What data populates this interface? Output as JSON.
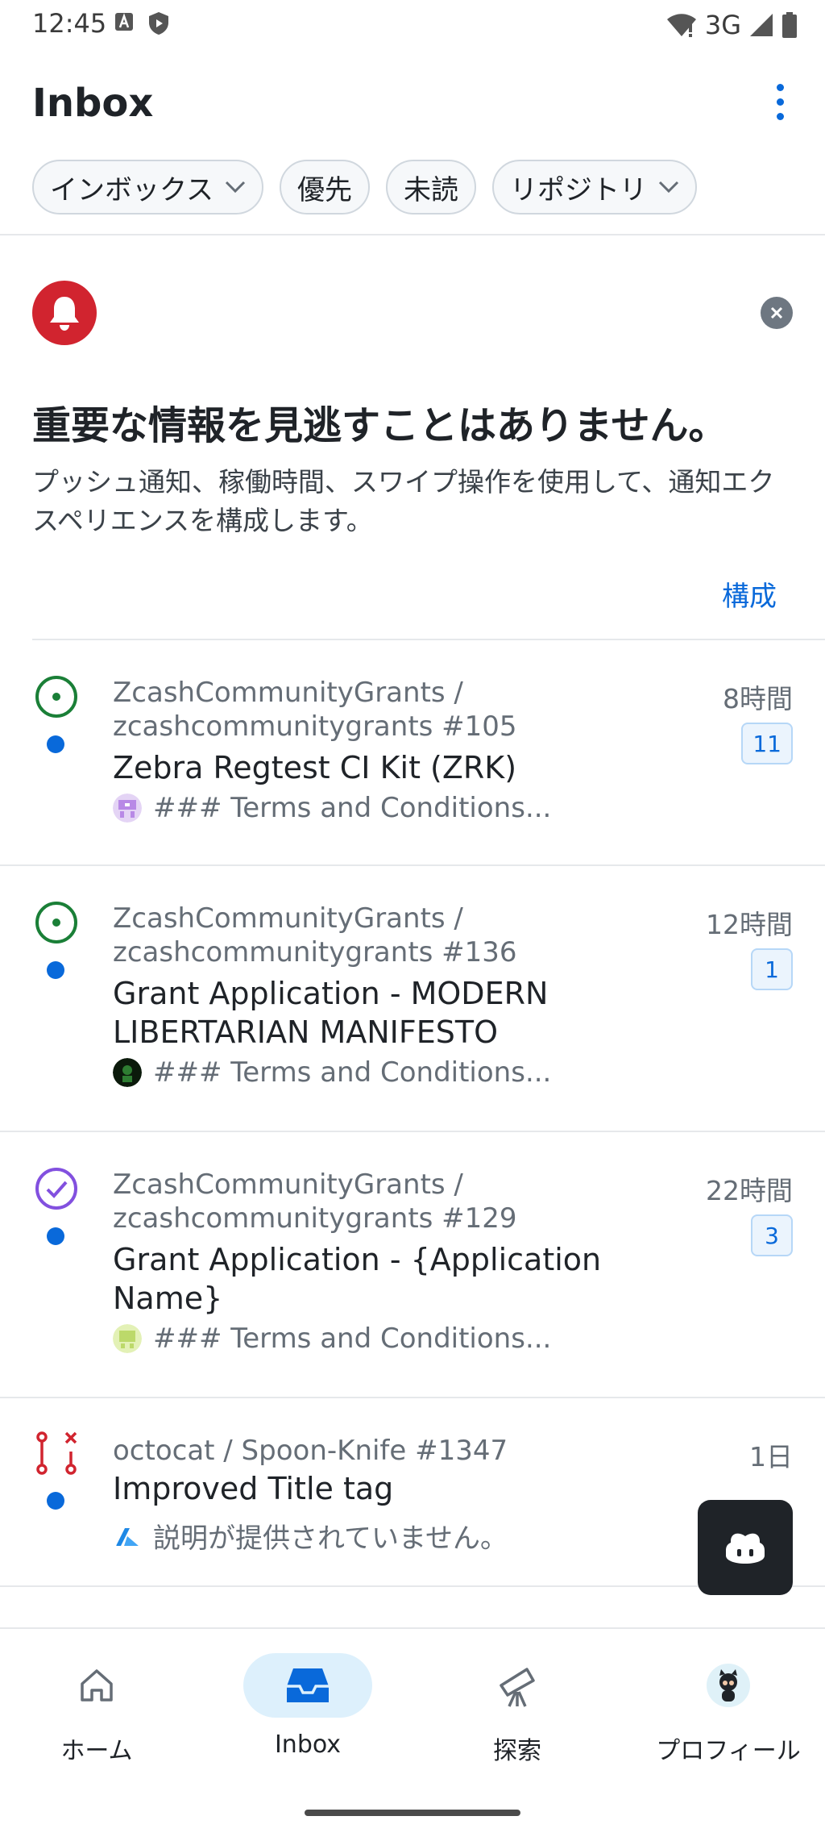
{
  "status_bar": {
    "time": "12:45",
    "network": "3G",
    "icons": [
      "a-box-icon",
      "shield-icon",
      "wifi-icon",
      "signal-icon",
      "battery-icon"
    ]
  },
  "header": {
    "title": "Inbox",
    "menu_icon": "kebab-menu-icon"
  },
  "filters": [
    {
      "label": "インボックス",
      "has_dropdown": true
    },
    {
      "label": "優先",
      "has_dropdown": false
    },
    {
      "label": "未読",
      "has_dropdown": false
    },
    {
      "label": "リポジトリ",
      "has_dropdown": true
    }
  ],
  "promo": {
    "icon": "bell-icon",
    "title": "重要な情報を見逃すことはありません。",
    "description": "プッシュ通知、稼働時間、スワイプ操作を使用して、通知エクスペリエンスを構成します。",
    "action": "構成"
  },
  "notifications": [
    {
      "state_icon": "issue-open-icon",
      "repo_line1": "ZcashCommunityGrants /",
      "repo_line2": "zcashcommunitygrants #105",
      "title": "Zebra Regtest CI Kit (ZRK)",
      "snippet": "### Terms and Conditions...",
      "time": "8時間",
      "count": "11",
      "unread": true
    },
    {
      "state_icon": "issue-open-icon",
      "repo_line1": "ZcashCommunityGrants /",
      "repo_line2": "zcashcommunitygrants #136",
      "title": "Grant Application - MODERN LIBERTARIAN MANIFESTO",
      "snippet": "### Terms and Conditions...",
      "time": "12時間",
      "count": "1",
      "unread": true
    },
    {
      "state_icon": "issue-closed-icon",
      "repo_line1": "ZcashCommunityGrants /",
      "repo_line2": "zcashcommunitygrants #129",
      "title": "Grant Application - {Application Name}",
      "snippet": "### Terms and Conditions...",
      "time": "22時間",
      "count": "3",
      "unread": true
    },
    {
      "state_icon": "pull-request-closed-icon",
      "repo_line1": "octocat / Spoon-Knife #1347",
      "title": "Improved Title tag",
      "snippet": "説明が提供されていません。",
      "time": "1日",
      "unread": true
    }
  ],
  "fab": {
    "icon": "copilot-icon"
  },
  "bottom_nav": [
    {
      "label": "ホーム",
      "icon": "home-icon",
      "active": false
    },
    {
      "label": "Inbox",
      "icon": "inbox-icon",
      "active": true
    },
    {
      "label": "探索",
      "icon": "telescope-icon",
      "active": false
    },
    {
      "label": "プロフィール",
      "icon": "avatar-icon",
      "active": false
    }
  ],
  "colors": {
    "accent": "#0969da",
    "open": "#1a7f37",
    "closed": "#8250df",
    "pr_closed": "#d1242f",
    "bell": "#d1242f"
  }
}
